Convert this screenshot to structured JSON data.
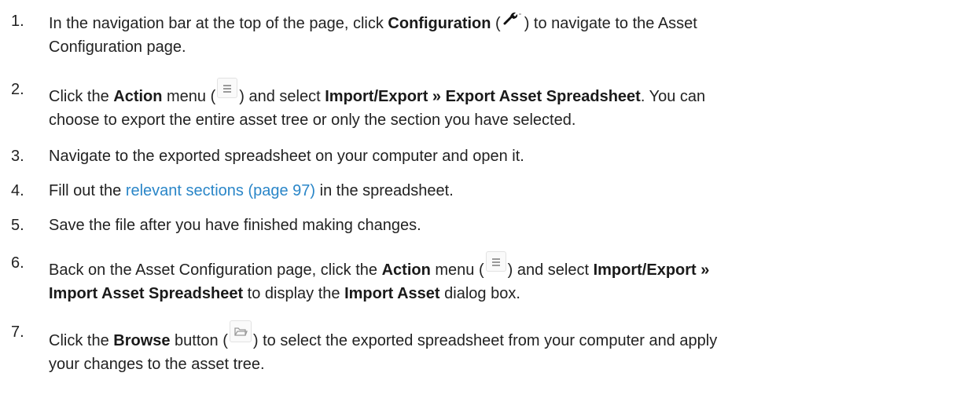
{
  "steps": [
    {
      "number": "1.",
      "line1_a": "In the navigation bar at the top of the page, click ",
      "line1_bold": "Configuration",
      "line1_b": " (",
      "icon": "wrench-icon",
      "line1_c": ") to navigate to the Asset",
      "line2": "Configuration page."
    },
    {
      "number": "2.",
      "a": "Click the ",
      "bold1": "Action",
      "b": " menu (",
      "icon": "menu-icon",
      "c": ") and select ",
      "bold2": "Import/Export » Export Asset Spreadsheet",
      "d": ". You can",
      "line2": "choose to export the entire asset tree or only the section you have selected."
    },
    {
      "number": "3.",
      "text": "Navigate to the exported spreadsheet on your computer and open it."
    },
    {
      "number": "4.",
      "a": "Fill out the ",
      "link": "relevant sections (page 97)",
      "b": " in the spreadsheet."
    },
    {
      "number": "5.",
      "text": "Save the file after you have finished making changes."
    },
    {
      "number": "6.",
      "a": "Back on the Asset Configuration page, click the ",
      "bold1": "Action",
      "b": " menu (",
      "icon": "menu-icon",
      "c": ") and select ",
      "bold2": "Import/Export »",
      "line2_bold1": "Import Asset Spreadsheet",
      "line2_a": " to display the ",
      "line2_bold2": "Import Asset",
      "line2_b": " dialog box."
    },
    {
      "number": "7.",
      "a": "Click the ",
      "bold1": "Browse",
      "b": " button (",
      "icon": "folder-icon",
      "c": ") to select the exported spreadsheet from your computer and apply",
      "line2": "your changes to the asset tree."
    }
  ],
  "colors": {
    "link": "#2a86c8",
    "text": "#222222"
  }
}
